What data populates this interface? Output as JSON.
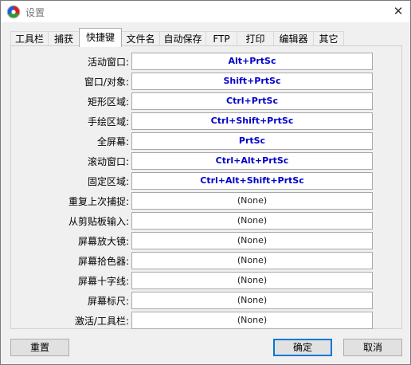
{
  "window": {
    "title": "设置",
    "close_label": "✕"
  },
  "tabs": [
    {
      "label": "工具栏"
    },
    {
      "label": "捕获"
    },
    {
      "label": "快捷键",
      "active": true
    },
    {
      "label": "文件名"
    },
    {
      "label": "自动保存"
    },
    {
      "label": "FTP"
    },
    {
      "label": "打印"
    },
    {
      "label": "编辑器"
    },
    {
      "label": "其它"
    }
  ],
  "hotkeys": [
    {
      "label": "活动窗口:",
      "value": "Alt+PrtSc",
      "set": true
    },
    {
      "label": "窗口/对象:",
      "value": "Shift+PrtSc",
      "set": true
    },
    {
      "label": "矩形区域:",
      "value": "Ctrl+PrtSc",
      "set": true
    },
    {
      "label": "手绘区域:",
      "value": "Ctrl+Shift+PrtSc",
      "set": true
    },
    {
      "label": "全屏幕:",
      "value": "PrtSc",
      "set": true
    },
    {
      "label": "滚动窗口:",
      "value": "Ctrl+Alt+PrtSc",
      "set": true
    },
    {
      "label": "固定区域:",
      "value": "Ctrl+Alt+Shift+PrtSc",
      "set": true
    },
    {
      "label": "重复上次捕捉:",
      "value": "(None)",
      "set": false
    },
    {
      "label": "从剪贴板输入:",
      "value": "(None)",
      "set": false
    },
    {
      "label": "屏幕放大镜:",
      "value": "(None)",
      "set": false
    },
    {
      "label": "屏幕拾色器:",
      "value": "(None)",
      "set": false
    },
    {
      "label": "屏幕十字线:",
      "value": "(None)",
      "set": false
    },
    {
      "label": "屏幕标尺:",
      "value": "(None)",
      "set": false
    },
    {
      "label": "激活/工具栏:",
      "value": "(None)",
      "set": false
    }
  ],
  "buttons": {
    "reset": "重置",
    "ok": "确定",
    "cancel": "取消"
  },
  "colors": {
    "hotkey_set": "#0000cc",
    "accent": "#0078d7"
  },
  "icons": {
    "app": "faststone-capture-icon",
    "close": "close-icon"
  }
}
